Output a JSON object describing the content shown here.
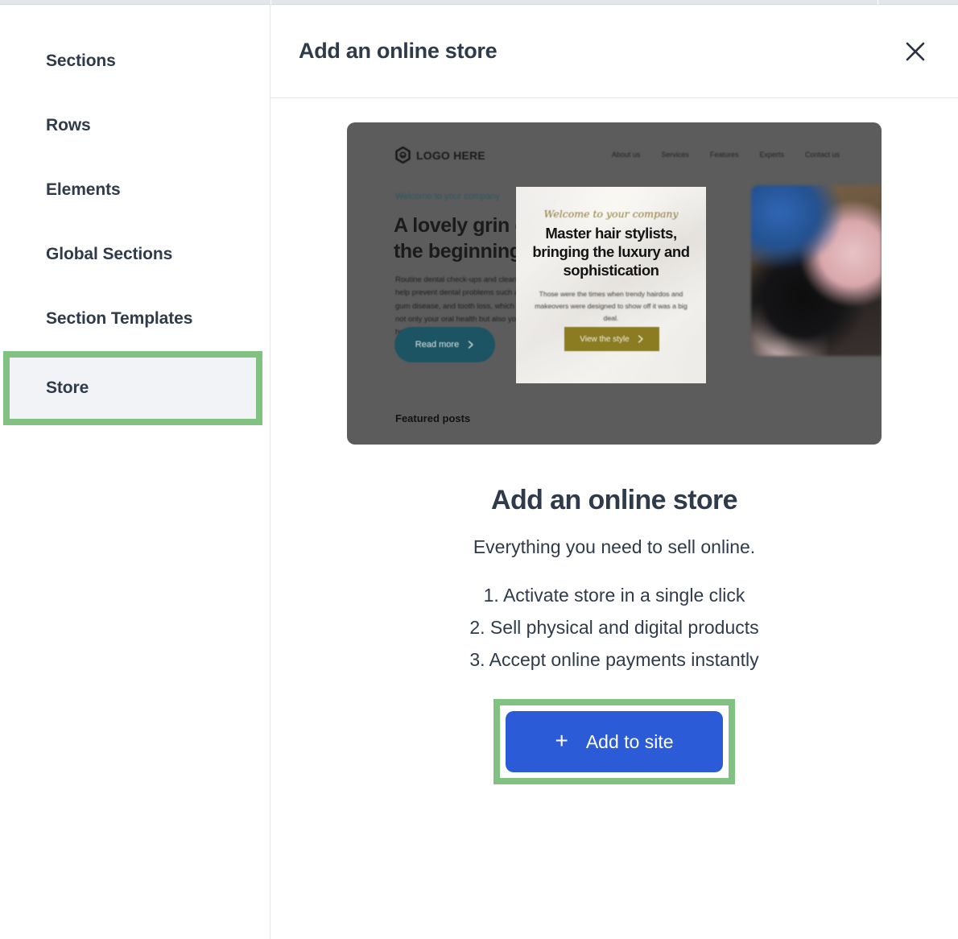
{
  "colors": {
    "highlight_green": "#81c181",
    "primary_blue": "#2b5bd7",
    "text_dark": "#2f3a4a",
    "sidebar_selected_bg": "#f1f3f7",
    "preview_bg": "#5c5c5c",
    "preview_cta_teal": "#1d5463",
    "overlay_cta_gold": "#8b7c22"
  },
  "sidebar": {
    "items": [
      {
        "label": "Sections",
        "selected": false
      },
      {
        "label": "Rows",
        "selected": false
      },
      {
        "label": "Elements",
        "selected": false
      },
      {
        "label": "Global Sections",
        "selected": false
      },
      {
        "label": "Section Templates",
        "selected": false
      },
      {
        "label": "Store",
        "selected": true
      }
    ]
  },
  "panel": {
    "header": {
      "title": "Add an online store",
      "close_icon": "close-icon"
    },
    "preview": {
      "site": {
        "logo_text": "LOGO HERE",
        "logo_icon": "hexagon-logo-icon",
        "nav": [
          "About us",
          "Services",
          "Features",
          "Experts",
          "Contact us"
        ],
        "eyebrow": "Welcome to your company",
        "heading": "A lovely grin can be the beginning",
        "body": "Routine dental check-ups and cleanings can help prevent dental problems such as cavities, gum disease, and tooth loss, which can affect not only your oral health but also your overall health.",
        "cta_label": "Read more",
        "cta_icon": "chevron-right-icon",
        "featured_label": "Featured posts",
        "photo_alt": "blurred-salon-photo"
      },
      "overlay_card": {
        "eyebrow": "Welcome to your company",
        "heading": "Master hair stylists, bringing the luxury and sophistication",
        "body": "Those were the times when trendy hairdos and makeovers were designed to show off it was a big deal.",
        "cta_label": "View the style",
        "cta_icon": "chevron-right-icon"
      }
    },
    "content": {
      "title": "Add an online store",
      "subtitle": "Everything you need to sell online.",
      "features": [
        "1. Activate store in a single click",
        "2. Sell physical and digital products",
        "3. Accept online payments instantly"
      ],
      "cta": {
        "label": "Add to site",
        "icon": "plus-icon"
      }
    }
  }
}
